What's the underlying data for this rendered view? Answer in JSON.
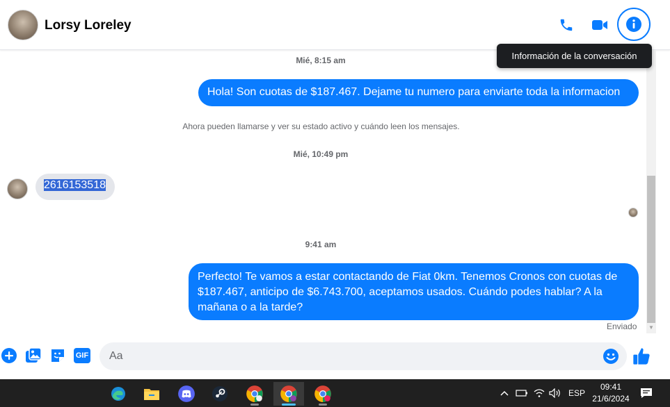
{
  "colors": {
    "accent": "#0a7cff",
    "taskbar": "#202020",
    "bubble_in": "#e4e6eb"
  },
  "header": {
    "contact_name": "Lorsy Loreley",
    "icons": [
      "phone-icon",
      "video-camera-icon",
      "info-icon"
    ],
    "tooltip": "Información de la conversación"
  },
  "messages": {
    "stamp1": "Mié, 8:15 am",
    "msg1": "Hola! Son cuotas de $187.467. Dejame tu numero para enviarte toda la informacion",
    "system": "Ahora pueden llamarse y ver su estado activo y cuándo leen los mensajes.",
    "stamp2": "Mié, 10:49 pm",
    "msg2": "2616153518",
    "stamp3": "9:41 am",
    "msg3_line1": "Perfecto! Te vamos a estar contactando de Fiat 0km. Tenemos Cronos con cuotas de",
    "msg3_line2": "$187.467, anticipo de $6.743.700, aceptamos usados. Cuándo podes hablar? A la",
    "msg3_line3": "mañana o a la tarde?",
    "status": "Enviado"
  },
  "composer": {
    "placeholder": "Aa",
    "icons": [
      "plus-icon",
      "photo-icon",
      "sticker-icon",
      "gif-icon",
      "emoji-icon",
      "thumbs-up-icon"
    ],
    "gif_label": "GIF"
  },
  "taskbar": {
    "apps": [
      "edge-icon",
      "file-explorer-icon",
      "discord-icon",
      "steam-icon",
      "chrome-icon",
      "chrome-icon",
      "chrome-icon"
    ],
    "language": "ESP",
    "time": "09:41",
    "date": "21/6/2024"
  }
}
